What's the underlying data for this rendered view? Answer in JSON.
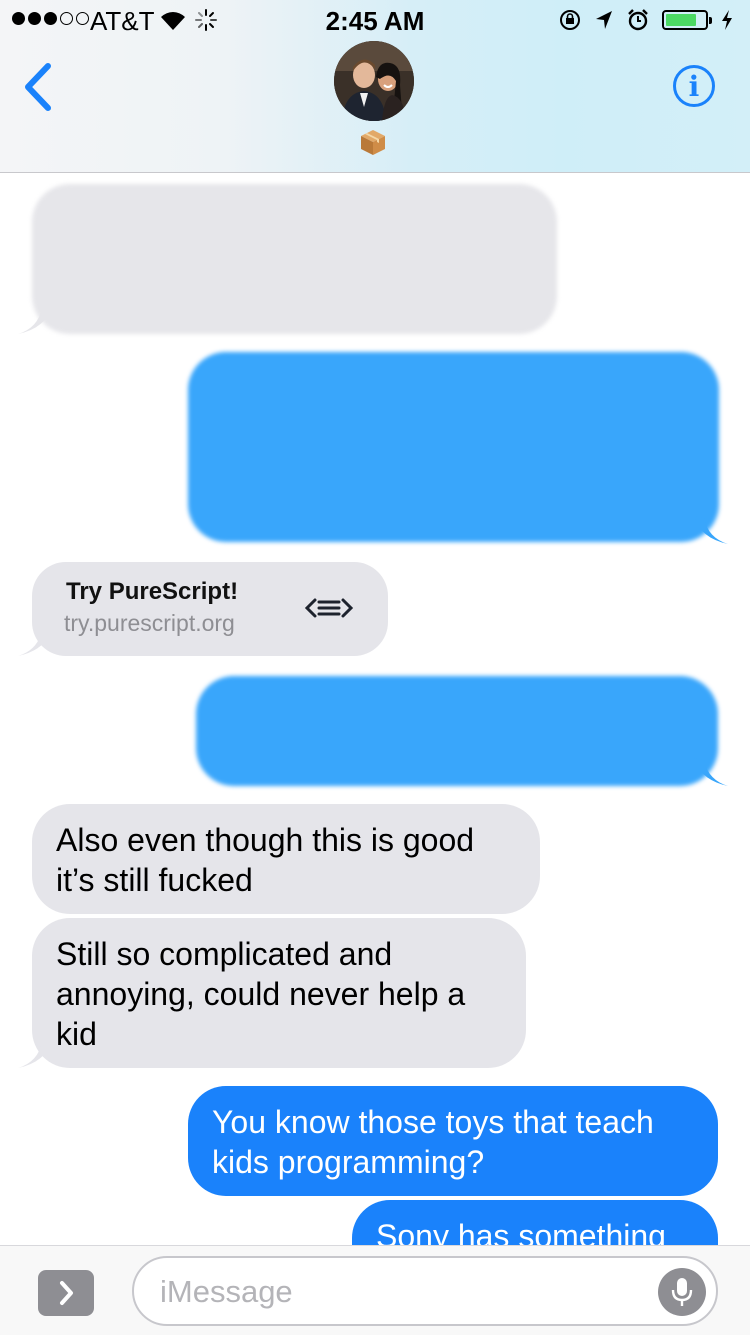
{
  "status_bar": {
    "carrier": "AT&T",
    "time": "2:45 AM",
    "battery_level": 0.8,
    "signal_bars": 3
  },
  "colors": {
    "imessage_blue": "#1a82fb",
    "incoming_gray": "#e5e5ea",
    "battery_green": "#4cd964"
  },
  "header": {
    "back_icon": "chevron-left-icon",
    "info_icon": "info-icon",
    "status_emoji_icon": "package-icon"
  },
  "link_preview": {
    "title": "Try PureScript!",
    "url": "try.purescript.org",
    "icon": "purescript-logo-icon"
  },
  "messages": [
    {
      "direction": "in",
      "text": "Also even though this is good it’s still fucked"
    },
    {
      "direction": "in",
      "text": "Still so complicated and annoying, could never help a kid"
    },
    {
      "direction": "out",
      "text": "You know those toys that teach kids programming?"
    },
    {
      "direction": "out",
      "text": "Sony has something"
    }
  ],
  "input_bar": {
    "placeholder": "iMessage",
    "apps_icon": "chevron-right-icon",
    "mic_icon": "microphone-icon"
  }
}
